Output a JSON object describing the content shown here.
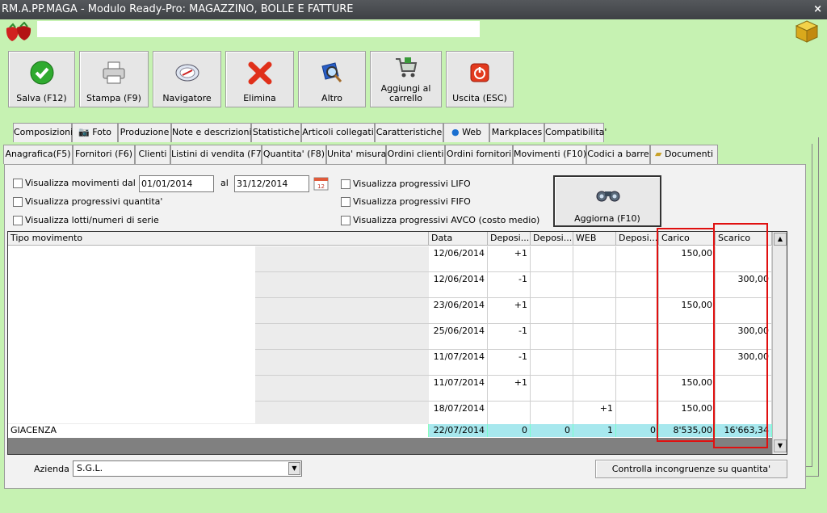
{
  "window": {
    "title": "RM.A.PP.MAGA - Modulo Ready-Pro: MAGAZZINO, BOLLE E FATTURE",
    "close": "×"
  },
  "toolbar": [
    {
      "label": "Salva (F12)",
      "icon": "check-icon"
    },
    {
      "label": "Stampa (F9)",
      "icon": "printer-icon"
    },
    {
      "label": "Navigatore",
      "icon": "compass-icon"
    },
    {
      "label": "Elimina",
      "icon": "delete-x-icon"
    },
    {
      "label": "Altro",
      "icon": "book-search-icon"
    },
    {
      "label": "Aggiungi al carrello",
      "icon": "cart-icon"
    },
    {
      "label": "Uscita (ESC)",
      "icon": "power-icon"
    }
  ],
  "tabs_row1": [
    "Composizioni",
    "Foto",
    "Produzione",
    "Note e descrizioni",
    "Statistiche",
    "Articoli collegati",
    "Caratteristiche",
    "Web",
    "Markplaces",
    "Compatibilita'"
  ],
  "tabs_row2": [
    "Anagrafica(F5)",
    "Fornitori (F6)",
    "Clienti",
    "Listini di vendita (F7)",
    "Quantita' (F8)",
    "Unita' misura",
    "Ordini clienti",
    "Ordini fornitori",
    "Movimenti (F10)",
    "Codici a barre",
    "Documenti"
  ],
  "filters": {
    "movimenti_dal": "Visualizza movimenti dal",
    "date_from": "01/01/2014",
    "al": "al",
    "date_to": "31/12/2014",
    "progressivi_quantita": "Visualizza progressivi quantita'",
    "lotti": "Visualizza lotti/numeri di serie",
    "lifo": "Visualizza progressivi LIFO",
    "fifo": "Visualizza progressivi FIFO",
    "avco": "Visualizza progressivi AVCO (costo medio)",
    "aggiorna": "Aggiorna (F10)"
  },
  "grid": {
    "headers": [
      "Tipo movimento",
      "Data",
      "Deposi...",
      "Deposi...",
      "WEB",
      "Deposi...",
      "Carico",
      "Scarico"
    ],
    "rows": [
      {
        "data": "12/06/2014",
        "d1": "+1",
        "d2": "",
        "web": "",
        "d3": "",
        "carico": "150,00",
        "scarico": ""
      },
      {
        "data": "12/06/2014",
        "d1": "-1",
        "d2": "",
        "web": "",
        "d3": "",
        "carico": "",
        "scarico": "300,00"
      },
      {
        "data": "23/06/2014",
        "d1": "+1",
        "d2": "",
        "web": "",
        "d3": "",
        "carico": "150,00",
        "scarico": ""
      },
      {
        "data": "25/06/2014",
        "d1": "-1",
        "d2": "",
        "web": "",
        "d3": "",
        "carico": "",
        "scarico": "300,00"
      },
      {
        "data": "11/07/2014",
        "d1": "-1",
        "d2": "",
        "web": "",
        "d3": "",
        "carico": "",
        "scarico": "300,00"
      },
      {
        "data": "11/07/2014",
        "d1": "+1",
        "d2": "",
        "web": "",
        "d3": "",
        "carico": "150,00",
        "scarico": ""
      },
      {
        "data": "18/07/2014",
        "d1": "",
        "d2": "",
        "web": "+1",
        "d3": "",
        "carico": "150,00",
        "scarico": ""
      }
    ],
    "giacenza": {
      "label": "GIACENZA",
      "data": "22/07/2014",
      "d1": "0",
      "d2": "0",
      "web": "1",
      "d3": "0",
      "carico": "8'535,00",
      "scarico": "16'663,34"
    }
  },
  "footer": {
    "azienda_label": "Azienda :",
    "azienda_value": "S.G.L.",
    "controlla": "Controlla incongruenze su quantita'"
  },
  "colors": {
    "background": "#c6f2b2",
    "highlight": "#a7e8ee",
    "annotation": "#e01010"
  }
}
